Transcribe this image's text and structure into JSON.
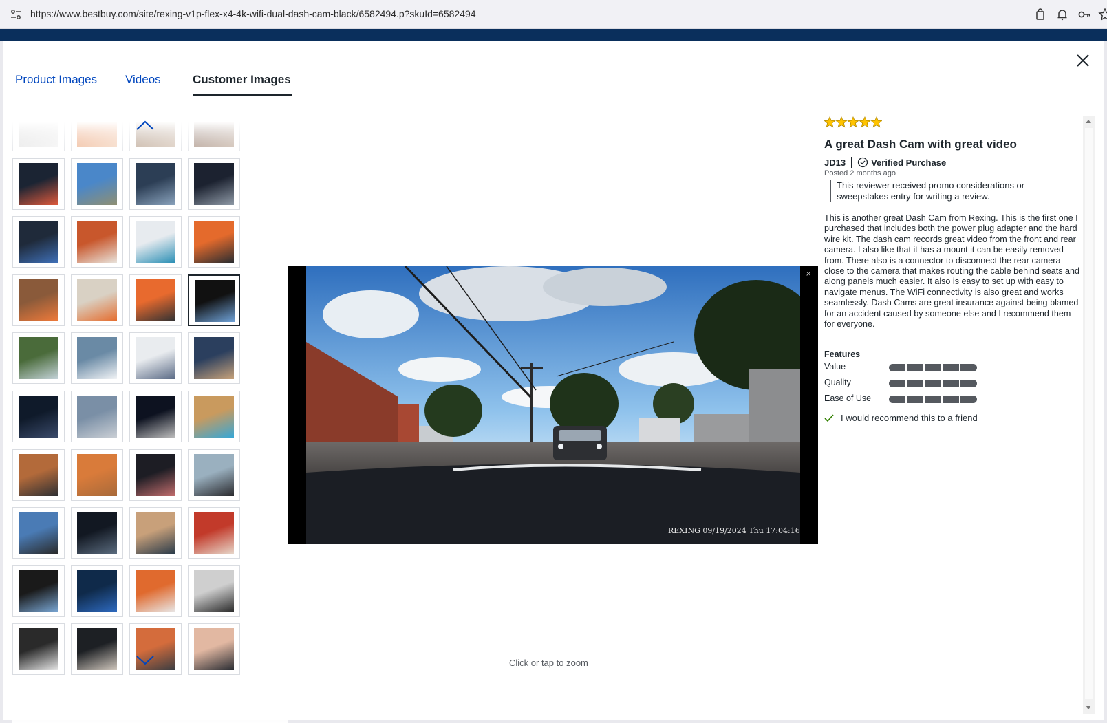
{
  "browser": {
    "url": "https://www.bestbuy.com/site/rexing-v1p-flex-x4-4k-wifi-dual-dash-cam-black/6582494.p?skuId=6582494",
    "icons": [
      "site-info-icon",
      "cart-icon",
      "bell-icon",
      "key-icon",
      "star-icon"
    ]
  },
  "tabs": [
    {
      "label": "Product Images",
      "active": false
    },
    {
      "label": "Videos",
      "active": false
    },
    {
      "label": "Customer Images",
      "active": true
    }
  ],
  "thumbnails": {
    "columns": 4,
    "rows": 10,
    "selected_index": 15
  },
  "main_image": {
    "overlay_text": "REXING 09/19/2024 Thu 17:04:16",
    "zoom_hint": "Click or tap to zoom"
  },
  "review": {
    "rating": 5,
    "rating_max": 5,
    "star_color": "#ffc300",
    "title": "A great Dash Cam with great video",
    "author": "JD13",
    "verified_label": "Verified Purchase",
    "posted": "Posted 2 months ago",
    "promo_note": "This reviewer received promo considerations or sweepstakes entry for writing a review.",
    "body": "This is another great Dash Cam from Rexing. This is the first one I purchased that includes both the power plug adapter and the hard wire kit. The dash cam records great video from the front and rear camera. I also like that it has a mount it can be easily removed from. There also is a connector to disconnect the rear camera close to the camera that makes routing the cable behind seats and along panels much easier. It also is easy to set up with easy to navigate menus. The WiFi connectivity is also great and works seamlessly. Dash Cams are great insurance against being blamed for an accident caused by someone else and I recommend them for everyone.",
    "features_heading": "Features",
    "features": [
      {
        "label": "Value",
        "score": 5,
        "max": 5
      },
      {
        "label": "Quality",
        "score": 5,
        "max": 5
      },
      {
        "label": "Ease of Use",
        "score": 5,
        "max": 5
      }
    ],
    "recommend_text": "I would recommend this to a friend"
  },
  "colors": {
    "link_blue": "#0046be",
    "header_navy": "#0a2f5c",
    "text_dark": "#1d252c",
    "bar_gray": "#55595f"
  }
}
